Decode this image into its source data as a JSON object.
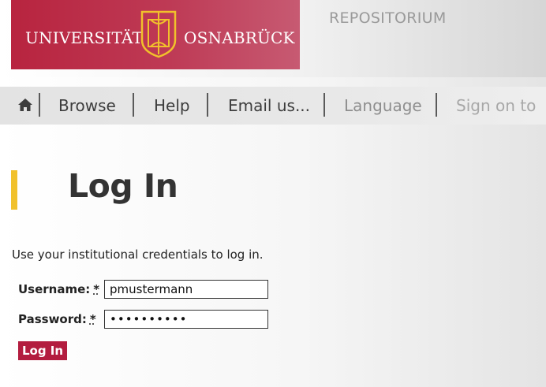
{
  "header": {
    "logo_left": "UNIVERSITÄT",
    "logo_right": "OSNABRÜCK",
    "repository": "REPOSITORIUM",
    "brand_color": "#b8243f"
  },
  "nav": {
    "home_icon": "home-icon",
    "items": [
      {
        "label": "Browse"
      },
      {
        "label": "Help"
      },
      {
        "label": "Email us..."
      },
      {
        "label": "Language"
      },
      {
        "label": "Sign on to"
      }
    ]
  },
  "page": {
    "title": "Log In",
    "accent_color": "#f1c12b",
    "intro": "Use your institutional credentials to log in."
  },
  "form": {
    "username_label": "Username:",
    "password_label": "Password:",
    "required_marker": "*",
    "username_value": "pmustermann",
    "password_value": "••••••••••",
    "submit_label": "Log In"
  }
}
